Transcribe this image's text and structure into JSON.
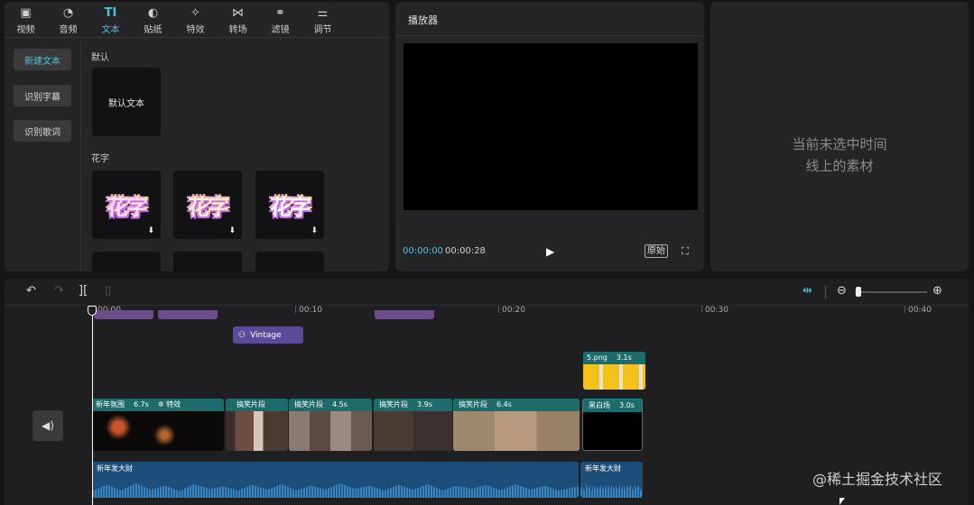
{
  "library": {
    "tabs": [
      {
        "label": "视频",
        "icon": "video-icon"
      },
      {
        "label": "音频",
        "icon": "audio-icon"
      },
      {
        "label": "文本",
        "icon": "text-icon",
        "active": true
      },
      {
        "label": "贴纸",
        "icon": "sticker-icon"
      },
      {
        "label": "特效",
        "icon": "effects-icon"
      },
      {
        "label": "转场",
        "icon": "transition-icon"
      },
      {
        "label": "滤镜",
        "icon": "filter-icon"
      },
      {
        "label": "调节",
        "icon": "adjust-icon"
      }
    ],
    "side": {
      "new_text": "新建文本",
      "recognize_subtitle": "识别字幕",
      "recognize_lyrics": "识别歌词"
    },
    "default_section": "默认",
    "default_card": "默认文本",
    "huazi_section": "花字",
    "huazi_sample": "花字"
  },
  "player": {
    "title": "播放器",
    "current_time": "00:00:00",
    "total_time": "00:00:28",
    "original_label": "原始"
  },
  "properties": {
    "empty_line1": "当前未选中时间",
    "empty_line2": "线上的素材"
  },
  "timeline": {
    "ruler": [
      "00:00",
      "00:10",
      "00:20",
      "00:30",
      "00:40"
    ],
    "effect_clip": "Vintage",
    "image_clip": {
      "name": "5.png",
      "duration": "3.1s"
    },
    "video_clips": [
      {
        "name": "新年氛围",
        "duration": "6.7s",
        "extra": "特效"
      },
      {
        "name": "搞笑片段",
        "duration": ""
      },
      {
        "name": "搞笑片段",
        "duration": "4.5s"
      },
      {
        "name": "搞笑片段",
        "duration": "3.9s"
      },
      {
        "name": "搞笑片段",
        "duration": "6.4s"
      },
      {
        "name": "黑白场",
        "duration": "3.0s"
      }
    ],
    "audio_clips": [
      {
        "name": "新年发大财"
      },
      {
        "name": "新年发大财"
      }
    ]
  },
  "watermark": "@稀土掘金技术社区"
}
